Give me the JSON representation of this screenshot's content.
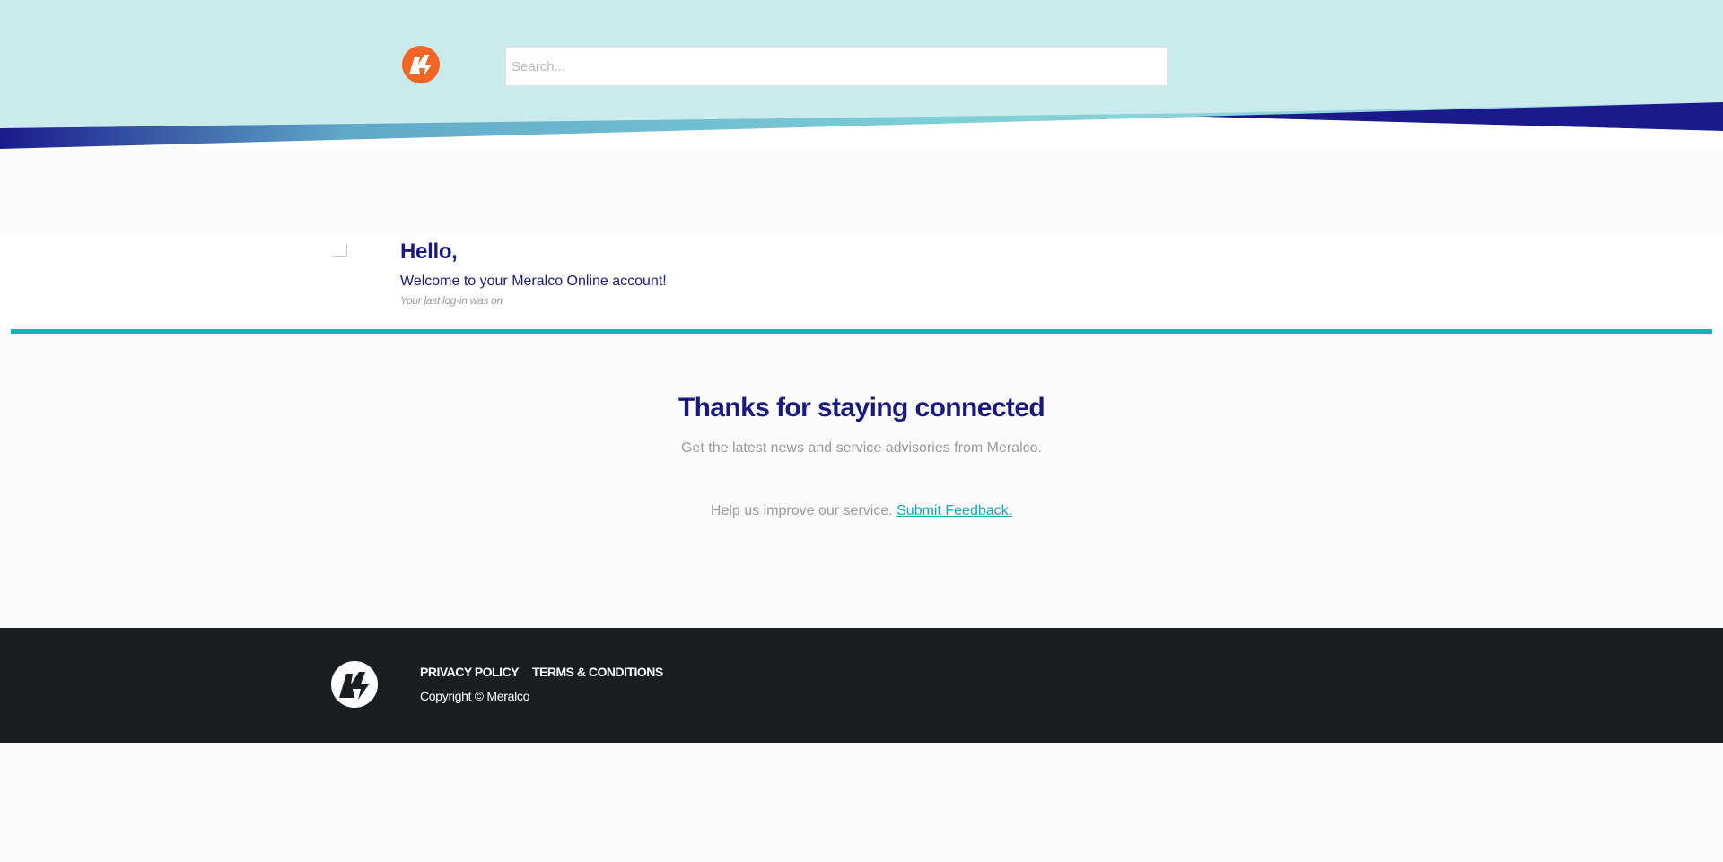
{
  "header": {
    "logo_icon": "meralco-logo-icon",
    "search": {
      "placeholder": "Search...",
      "value": ""
    },
    "colors": {
      "background": "#cbeaec",
      "wave_dark": "#1a1a8c",
      "wave_light": "#7ccfd6"
    }
  },
  "greeting": {
    "hello": "Hello,",
    "welcome": "Welcome to your Meralco Online account!",
    "last_login": "Your last log-in was on"
  },
  "main": {
    "title": "Thanks for staying connected",
    "subtitle": "Get the latest news and service advisories from Meralco.",
    "feedback_prefix": "Help us improve our service.",
    "feedback_link": "Submit Feedback."
  },
  "footer": {
    "logo_icon": "meralco-logo-icon",
    "links": [
      "PRIVACY POLICY",
      "TERMS & CONDITIONS"
    ],
    "copyright": "Copyright © Meralco"
  },
  "colors": {
    "brand_navy": "#1a1a7e",
    "brand_orange": "#f26522",
    "accent_teal": "#12b4bb",
    "footer_bg": "#1a1e21"
  }
}
